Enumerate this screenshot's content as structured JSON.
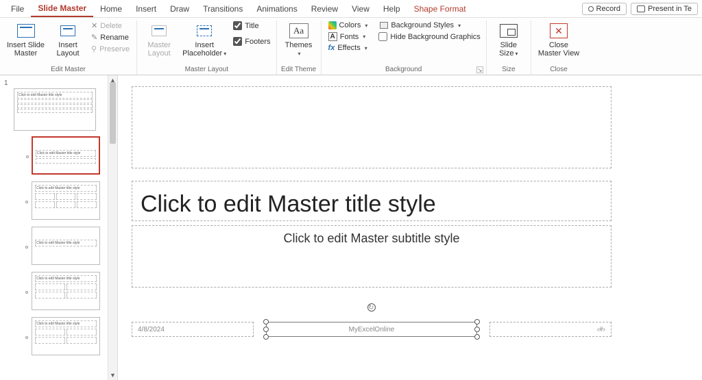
{
  "tabs": {
    "file": "File",
    "slide_master": "Slide Master",
    "home": "Home",
    "insert": "Insert",
    "draw": "Draw",
    "transitions": "Transitions",
    "animations": "Animations",
    "review": "Review",
    "view": "View",
    "help": "Help",
    "shape_format": "Shape Format",
    "record": "Record",
    "present": "Present in Te"
  },
  "ribbon": {
    "edit_master": {
      "label": "Edit Master",
      "insert_slide_master": "Insert Slide\nMaster",
      "insert_layout": "Insert\nLayout",
      "delete": "Delete",
      "rename": "Rename",
      "preserve": "Preserve"
    },
    "master_layout": {
      "label": "Master Layout",
      "master_layout_btn": "Master\nLayout",
      "insert_placeholder": "Insert\nPlaceholder",
      "title_chk": "Title",
      "footers_chk": "Footers"
    },
    "edit_theme": {
      "label": "Edit Theme",
      "themes": "Themes"
    },
    "background": {
      "label": "Background",
      "colors": "Colors",
      "fonts": "Fonts",
      "effects": "Effects",
      "bg_styles": "Background Styles",
      "hide_bg": "Hide Background Graphics"
    },
    "size": {
      "label": "Size",
      "slide_size": "Slide\nSize"
    },
    "close": {
      "label": "Close",
      "close_master": "Close\nMaster View"
    }
  },
  "thumbs": {
    "index": "1",
    "master_title": "Click to edit Master title style",
    "layout_titles": [
      "Click to edit Master title style",
      "Click to edit Master title style",
      "Click to edit Master title style",
      "Click to edit Master title style",
      "Click to edit Master title style"
    ]
  },
  "slide": {
    "title": "Click to edit Master title style",
    "subtitle": "Click to edit Master subtitle style",
    "date": "4/8/2024",
    "footer_center": "MyExcelOnline",
    "footer_right": "‹#›"
  }
}
